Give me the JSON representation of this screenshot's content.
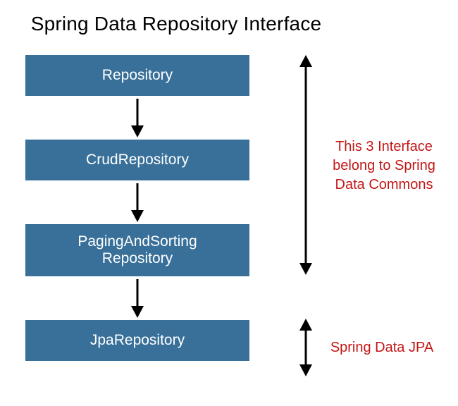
{
  "title": "Spring Data Repository Interface",
  "boxes": {
    "repository": "Repository",
    "crud": "CrudRepository",
    "paging_line1": "PagingAndSorting",
    "paging_line2": "Repository",
    "jpa": "JpaRepository"
  },
  "annotations": {
    "commons_line1": "This 3 Interface",
    "commons_line2": "belong to Spring",
    "commons_line3": "Data Commons",
    "jpa": "Spring Data JPA"
  },
  "colors": {
    "box_bg": "#387099",
    "box_text": "#ffffff",
    "annotation": "#c41616",
    "title": "#000000"
  }
}
